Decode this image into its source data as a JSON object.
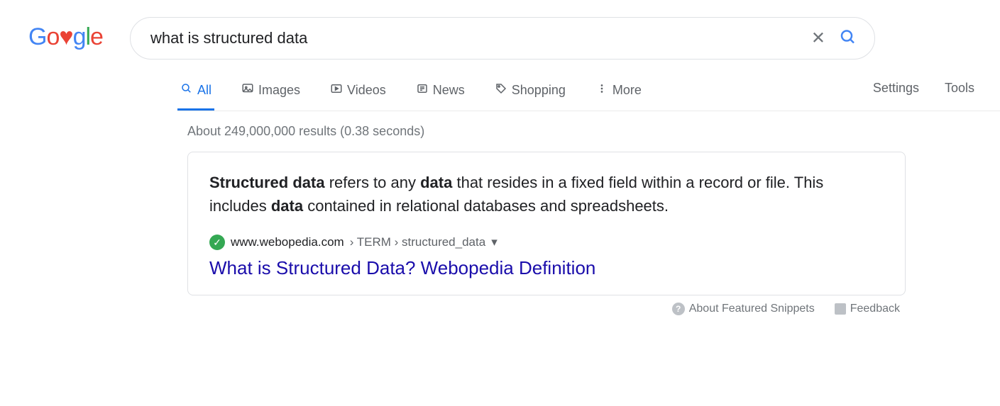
{
  "logo": {
    "text": "Google"
  },
  "search": {
    "query": "what is structured data"
  },
  "tabs": {
    "all": "All",
    "images": "Images",
    "videos": "Videos",
    "news": "News",
    "shopping": "Shopping",
    "more": "More"
  },
  "nav": {
    "settings": "Settings",
    "tools": "Tools"
  },
  "results_meta": "About 249,000,000 results (0.38 seconds)",
  "snippet": {
    "b1": "Structured data",
    "t1": " refers to any ",
    "b2": "data",
    "t2": " that resides in a fixed field within a record or file. This includes ",
    "b3": "data",
    "t3": " contained in relational databases and spreadsheets.",
    "url_host": "www.webopedia.com",
    "url_crumb": " › TERM › structured_data",
    "title": "What is Structured Data? Webopedia Definition"
  },
  "footer": {
    "about": "About Featured Snippets",
    "feedback": "Feedback"
  }
}
